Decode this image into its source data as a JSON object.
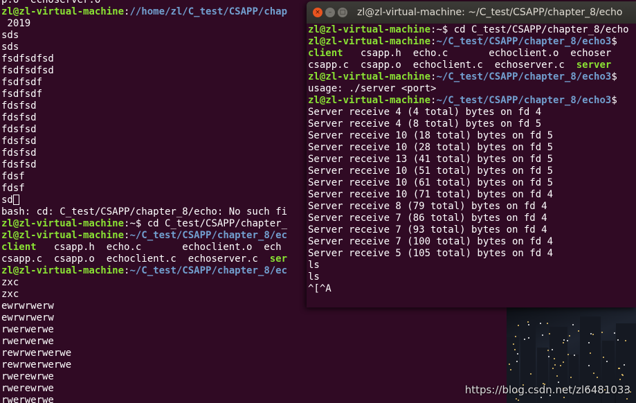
{
  "back_terminal": {
    "lines": [
      [
        {
          "t": "p.o  echoserver.o"
        }
      ],
      [
        {
          "t": "zl@zl-virtual-machine",
          "c": "user"
        },
        {
          "t": ":"
        },
        {
          "t": "//home/zl/C_test/CSAPP/chap",
          "c": "path"
        }
      ],
      [
        {
          "t": " 2019"
        }
      ],
      [
        {
          "t": "sds"
        }
      ],
      [
        {
          "t": "sds"
        }
      ],
      [
        {
          "t": "fsdfsdfsd"
        }
      ],
      [
        {
          "t": "fsdfsdfsd"
        }
      ],
      [
        {
          "t": "fsdfsdf"
        }
      ],
      [
        {
          "t": "fsdfsdf"
        }
      ],
      [
        {
          "t": "fdsfsd"
        }
      ],
      [
        {
          "t": "fdsfsd"
        }
      ],
      [
        {
          "t": "fdsfsd"
        }
      ],
      [
        {
          "t": "fdsfsd"
        }
      ],
      [
        {
          "t": "fdsfsd"
        }
      ],
      [
        {
          "t": "fdsfsd"
        }
      ],
      [
        {
          "t": "fdsf"
        }
      ],
      [
        {
          "t": "fdsf"
        }
      ],
      [
        {
          "t": "sd"
        },
        {
          "t": "",
          "c": "cursor"
        }
      ],
      [
        {
          "t": "bash: cd: C_test/CSAPP/chapter_8/echo: No such fi"
        }
      ],
      [
        {
          "t": "zl@zl-virtual-machine",
          "c": "user"
        },
        {
          "t": ":~$ cd C_test/CSAPP/chapter_"
        }
      ],
      [
        {
          "t": "zl@zl-virtual-machine",
          "c": "user"
        },
        {
          "t": ":"
        },
        {
          "t": "~/C_test/CSAPP/chapter_8/ec",
          "c": "path"
        }
      ],
      [
        {
          "t": "client",
          "c": "exec"
        },
        {
          "t": "   csapp.h  echo.c       echoclient.o  ech"
        }
      ],
      [
        {
          "t": "csapp.c  csapp.o  echoclient.c  echoserver.c  "
        },
        {
          "t": "ser",
          "c": "exec"
        }
      ],
      [
        {
          "t": "zl@zl-virtual-machine",
          "c": "user"
        },
        {
          "t": ":"
        },
        {
          "t": "~/C_test/CSAPP/chapter_8/ec",
          "c": "path"
        }
      ],
      [
        {
          "t": "zxc"
        }
      ],
      [
        {
          "t": "zxc"
        }
      ],
      [
        {
          "t": "ewrwrwerw"
        }
      ],
      [
        {
          "t": "ewrwrwerw"
        }
      ],
      [
        {
          "t": "rwerwerwe"
        }
      ],
      [
        {
          "t": "rwerwerwe"
        }
      ],
      [
        {
          "t": "rewrwerwerwe"
        }
      ],
      [
        {
          "t": "rewrwerwerwe"
        }
      ],
      [
        {
          "t": "rwerewrwe"
        }
      ],
      [
        {
          "t": "rwerewrwe"
        }
      ],
      [
        {
          "t": "rwerwerwe"
        }
      ]
    ]
  },
  "front_terminal": {
    "title": "zl@zl-virtual-machine: ~/C_test/CSAPP/chapter_8/echo",
    "buttons": {
      "close": "×",
      "minimize": "–",
      "maximize": "□"
    },
    "lines": [
      [
        {
          "t": "zl@zl-virtual-machine",
          "c": "user"
        },
        {
          "t": ":~$ cd C_test/CSAPP/chapter_8/echo"
        }
      ],
      [
        {
          "t": "zl@zl-virtual-machine",
          "c": "user"
        },
        {
          "t": ":"
        },
        {
          "t": "~/C_test/CSAPP/chapter_8/echo3",
          "c": "path"
        },
        {
          "t": "$"
        }
      ],
      [
        {
          "t": "client",
          "c": "exec"
        },
        {
          "t": "   csapp.h  echo.c       echoclient.o  echoser"
        }
      ],
      [
        {
          "t": "csapp.c  csapp.o  echoclient.c  echoserver.c  "
        },
        {
          "t": "server",
          "c": "exec"
        }
      ],
      [
        {
          "t": "zl@zl-virtual-machine",
          "c": "user"
        },
        {
          "t": ":"
        },
        {
          "t": "~/C_test/CSAPP/chapter_8/echo3",
          "c": "path"
        },
        {
          "t": "$"
        }
      ],
      [
        {
          "t": "usage: ./server <port>"
        }
      ],
      [
        {
          "t": "zl@zl-virtual-machine",
          "c": "user"
        },
        {
          "t": ":"
        },
        {
          "t": "~/C_test/CSAPP/chapter_8/echo3",
          "c": "path"
        },
        {
          "t": "$"
        }
      ],
      [
        {
          "t": "Server receive 4 (4 total) bytes on fd 4"
        }
      ],
      [
        {
          "t": "Server receive 4 (8 total) bytes on fd 5"
        }
      ],
      [
        {
          "t": "Server receive 10 (18 total) bytes on fd 5"
        }
      ],
      [
        {
          "t": "Server receive 10 (28 total) bytes on fd 5"
        }
      ],
      [
        {
          "t": "Server receive 13 (41 total) bytes on fd 5"
        }
      ],
      [
        {
          "t": "Server receive 10 (51 total) bytes on fd 5"
        }
      ],
      [
        {
          "t": "Server receive 10 (61 total) bytes on fd 5"
        }
      ],
      [
        {
          "t": "Server receive 10 (71 total) bytes on fd 4"
        }
      ],
      [
        {
          "t": "Server receive 8 (79 total) bytes on fd 4"
        }
      ],
      [
        {
          "t": "Server receive 7 (86 total) bytes on fd 4"
        }
      ],
      [
        {
          "t": "Server receive 7 (93 total) bytes on fd 4"
        }
      ],
      [
        {
          "t": "Server receive 7 (100 total) bytes on fd 4"
        }
      ],
      [
        {
          "t": "Server receive 5 (105 total) bytes on fd 4"
        }
      ],
      [
        {
          "t": "ls"
        }
      ],
      [
        {
          "t": "ls"
        }
      ],
      [
        {
          "t": "^[^A"
        }
      ]
    ]
  },
  "watermark": "https://blog.csdn.net/zl6481033",
  "colors": {
    "terminal_bg": "#300a24",
    "prompt_user": "#8ae234",
    "prompt_path": "#729fcf",
    "titlebar": "#3c3b37",
    "close_button": "#e95420"
  }
}
